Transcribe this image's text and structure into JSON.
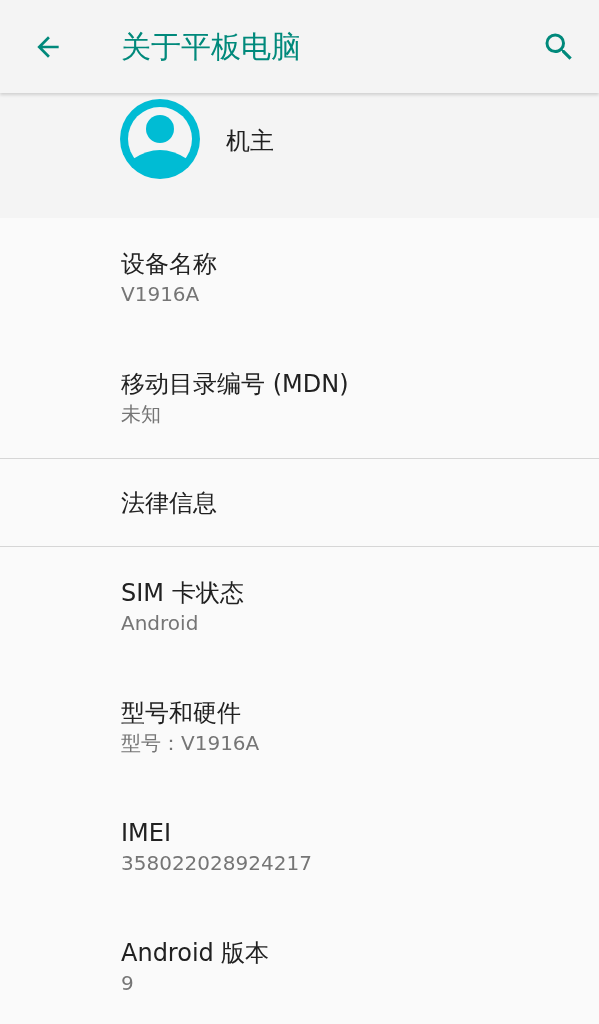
{
  "app_bar": {
    "title": "关于平板电脑"
  },
  "owner": {
    "name": "机主"
  },
  "groups": [
    {
      "items": [
        {
          "title": "设备名称",
          "summary": "V1916A"
        },
        {
          "title": "移动目录编号 (MDN)",
          "summary": "未知"
        }
      ]
    },
    {
      "items": [
        {
          "title": "法律信息"
        }
      ]
    },
    {
      "items": [
        {
          "title": "SIM 卡状态",
          "summary": "Android"
        },
        {
          "title": "型号和硬件",
          "summary": "型号：V1916A"
        },
        {
          "title": "IMEI",
          "summary": "358022028924217"
        },
        {
          "title": "Android 版本",
          "summary": "9"
        }
      ]
    }
  ]
}
